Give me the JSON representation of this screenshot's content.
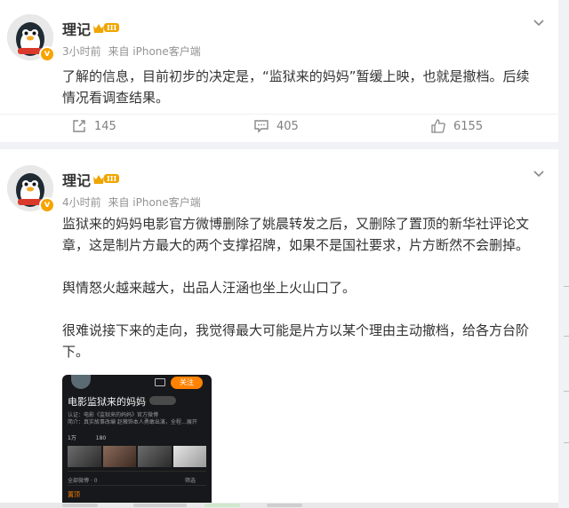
{
  "posts": [
    {
      "author": "理记",
      "vip_level": "III",
      "time": "3小时前",
      "source": "来自 iPhone客户端",
      "paragraphs": [
        "了解的信息，目前初步的决定是，“监狱来的妈妈”暂缓上映，也就是撤档。后续情况看调查结果。"
      ],
      "share_count": "145",
      "comment_count": "405",
      "like_count": "6155"
    },
    {
      "author": "理记",
      "vip_level": "III",
      "time": "4小时前",
      "source": "来自 iPhone客户端",
      "paragraphs": [
        "监狱来的妈妈电影官方微博删除了姚晨转发之后，又删除了置顶的新华社评论文章，这是制片方最大的两个支撑招牌，如果不是国社要求，片方断然不会删掉。",
        "舆情怒火越来越大，出品人汪涵也坐上火山口了。",
        "很难说接下来的走向，我觉得最大可能是片方以某个理由主动撤档，给各方台阶下。"
      ],
      "media": {
        "follow": "关注",
        "title": "电影监狱来的妈妈",
        "line1": "认证：电影《监狱来的妈妈》官方微博",
        "line2": "简介：真实故事改编   赵薇饰本人勇敢出演，全程…展开",
        "stat1": "1万",
        "stat2": "180",
        "all_label": "全部微博 · 0",
        "filter_label": "筛选",
        "pinned": "置顶"
      }
    }
  ],
  "colors": {
    "accent_orange": "#ff8200",
    "vip_gold": "#f0a500",
    "meta_gray": "#939393"
  },
  "icons": [
    "share-icon",
    "comment-icon",
    "like-icon",
    "chevron-down-icon",
    "verified-badge-icon",
    "crown-icon"
  ]
}
